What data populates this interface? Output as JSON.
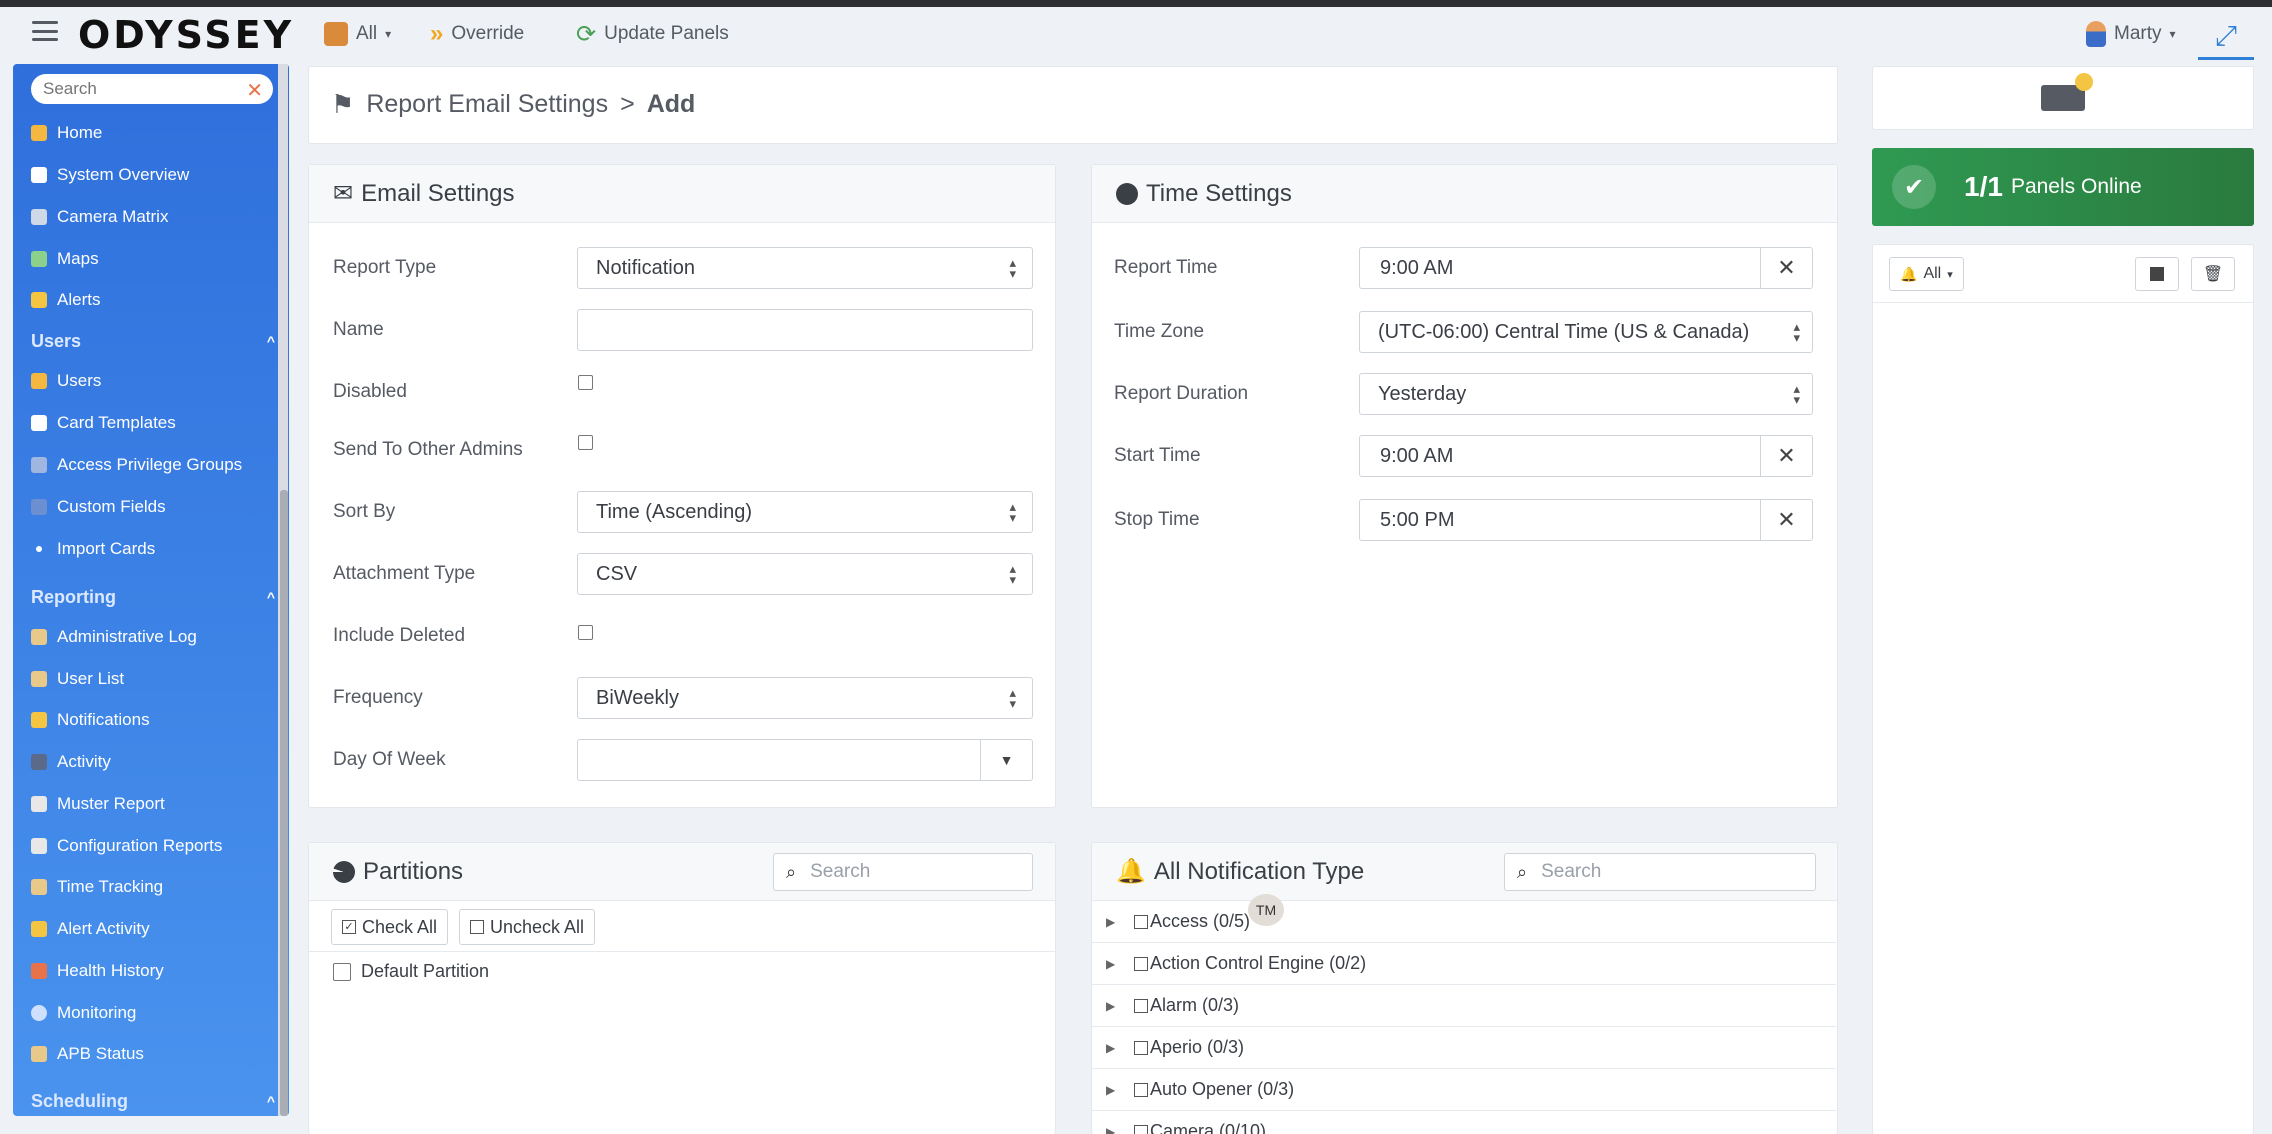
{
  "app": {
    "logo": "ODYSSEY",
    "nav": {
      "all_label": "All",
      "override_label": "Override",
      "update_label": "Update Panels",
      "user_name": "Marty"
    }
  },
  "sidebar": {
    "search_placeholder": "Search",
    "items": [
      {
        "label": "Home",
        "icon": "home-icon",
        "color": "#f4b740"
      },
      {
        "label": "System Overview",
        "icon": "system-overview-icon",
        "color": "#ffffff"
      },
      {
        "label": "Camera Matrix",
        "icon": "camera-icon",
        "color": "#cfd8e6"
      },
      {
        "label": "Maps",
        "icon": "map-icon",
        "color": "#8bd18b"
      },
      {
        "label": "Alerts",
        "icon": "bell-icon",
        "color": "#f4c542"
      }
    ],
    "users_section": {
      "title": "Users",
      "items": [
        {
          "label": "Users",
          "icon": "users-icon",
          "color": "#f4b740"
        },
        {
          "label": "Card Templates",
          "icon": "card-icon",
          "color": "#ffffff"
        },
        {
          "label": "Access Privilege Groups",
          "icon": "group-icon",
          "color": "#9fb7e0"
        },
        {
          "label": "Custom Fields",
          "icon": "fields-icon",
          "color": "#6b8fd0"
        },
        {
          "label": "Import Cards",
          "icon": "import-icon",
          "color": "#ffffff"
        }
      ]
    },
    "reporting_section": {
      "title": "Reporting",
      "items": [
        {
          "label": "Administrative Log",
          "icon": "log-icon",
          "color": "#e8c98a"
        },
        {
          "label": "User List",
          "icon": "list-icon",
          "color": "#e8c98a"
        },
        {
          "label": "Notifications",
          "icon": "bell-icon",
          "color": "#f4c542"
        },
        {
          "label": "Activity",
          "icon": "activity-icon",
          "color": "#5a6a88"
        },
        {
          "label": "Muster Report",
          "icon": "muster-icon",
          "color": "#e8e8e8"
        },
        {
          "label": "Configuration Reports",
          "icon": "config-icon",
          "color": "#e8e8e8"
        },
        {
          "label": "Time Tracking",
          "icon": "time-icon",
          "color": "#e8c98a"
        },
        {
          "label": "Alert Activity",
          "icon": "alert-activity-icon",
          "color": "#f4c542"
        },
        {
          "label": "Health History",
          "icon": "health-icon",
          "color": "#e8734a"
        },
        {
          "label": "Monitoring",
          "icon": "monitoring-icon",
          "color": "#cfe0ff"
        },
        {
          "label": "APB Status",
          "icon": "apb-icon",
          "color": "#e8c98a"
        }
      ]
    },
    "scheduling_section": {
      "title": "Scheduling"
    }
  },
  "breadcrumb": {
    "parent": "Report Email Settings",
    "separator": ">",
    "current": "Add"
  },
  "email_settings": {
    "title": "Email Settings",
    "report_type_label": "Report Type",
    "report_type_value": "Notification",
    "name_label": "Name",
    "name_value": "",
    "disabled_label": "Disabled",
    "send_admins_label": "Send To Other Admins",
    "sort_by_label": "Sort By",
    "sort_by_value": "Time (Ascending)",
    "attachment_label": "Attachment Type",
    "attachment_value": "CSV",
    "include_deleted_label": "Include Deleted",
    "frequency_label": "Frequency",
    "frequency_value": "BiWeekly",
    "day_of_week_label": "Day Of Week",
    "day_of_week_value": ""
  },
  "time_settings": {
    "title": "Time Settings",
    "report_time_label": "Report Time",
    "report_time_value": "9:00 AM",
    "time_zone_label": "Time Zone",
    "time_zone_value": "(UTC-06:00) Central Time (US & Canada)",
    "report_duration_label": "Report Duration",
    "report_duration_value": "Yesterday",
    "start_time_label": "Start Time",
    "start_time_value": "9:00 AM",
    "stop_time_label": "Stop Time",
    "stop_time_value": "5:00 PM"
  },
  "partitions": {
    "title": "Partitions",
    "search_placeholder": "Search",
    "check_all": "Check All",
    "uncheck_all": "Uncheck All",
    "items": [
      "Default Partition"
    ]
  },
  "notification_types": {
    "title": "All Notification Type",
    "search_placeholder": "Search",
    "tm_badge": "TM",
    "items": [
      "Access (0/5)",
      "Action Control Engine (0/2)",
      "Alarm (0/3)",
      "Aperio (0/3)",
      "Auto Opener (0/3)",
      "Camera (0/10)"
    ]
  },
  "panels": {
    "online_count": "1/1",
    "online_text": "Panels Online",
    "filter_label": "All"
  }
}
